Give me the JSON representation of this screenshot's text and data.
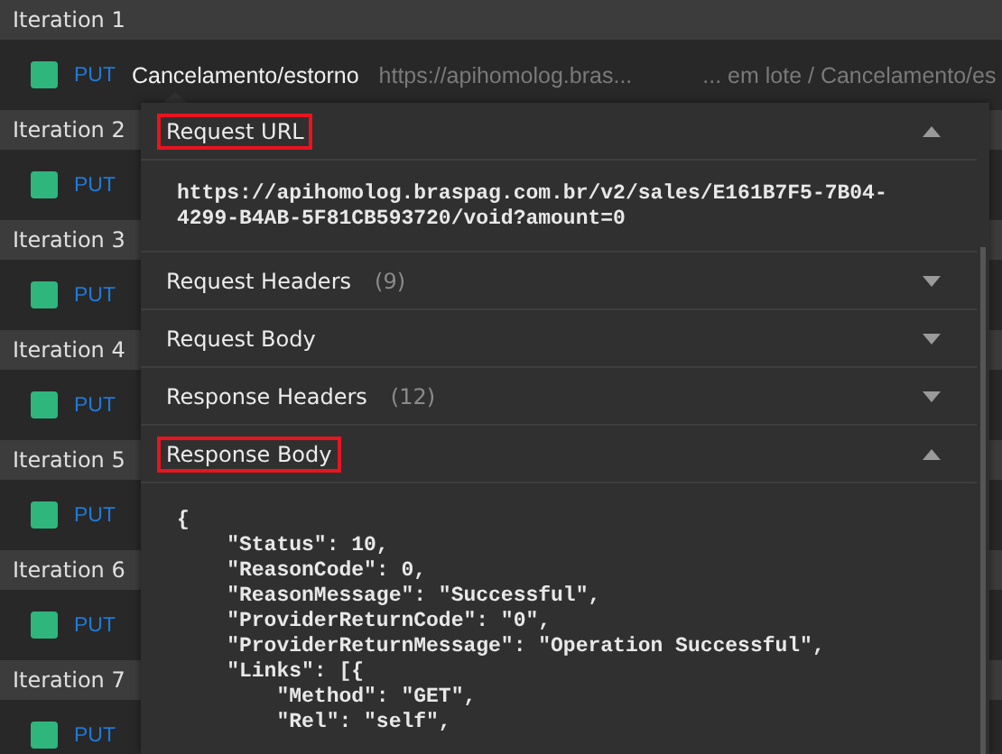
{
  "iterations": [
    {
      "title": "Iteration 1",
      "request": {
        "method": "PUT",
        "name": "Cancelamento/estorno",
        "url": "https://apihomolog.bras...",
        "path": "... em lote / Cancelamento/es"
      }
    },
    {
      "title": "Iteration 2",
      "request": {
        "method": "PUT"
      }
    },
    {
      "title": "Iteration 3",
      "request": {
        "method": "PUT"
      }
    },
    {
      "title": "Iteration 4",
      "request": {
        "method": "PUT"
      }
    },
    {
      "title": "Iteration 5",
      "request": {
        "method": "PUT"
      }
    },
    {
      "title": "Iteration 6",
      "request": {
        "method": "PUT"
      }
    },
    {
      "title": "Iteration 7",
      "request": {
        "method": "PUT"
      }
    }
  ],
  "details": {
    "sections": [
      {
        "title": "Request URL",
        "expanded": true,
        "highlighted": true,
        "kind": "text",
        "content": [
          "https://apihomolog.braspag.com.br/v2/sales/E161B7F5-7B04-",
          "4299-B4AB-5F81CB593720/void?amount=0"
        ]
      },
      {
        "title": "Request Headers",
        "count": "(9)",
        "expanded": false,
        "highlighted": false
      },
      {
        "title": "Request Body",
        "expanded": false,
        "highlighted": false
      },
      {
        "title": "Response Headers",
        "count": "(12)",
        "expanded": false,
        "highlighted": false
      },
      {
        "title": "Response Body",
        "expanded": true,
        "highlighted": true,
        "kind": "code",
        "content": [
          "{",
          "    \"Status\": 10,",
          "    \"ReasonCode\": 0,",
          "    \"ReasonMessage\": \"Successful\",",
          "    \"ProviderReturnCode\": \"0\",",
          "    \"ProviderReturnMessage\": \"Operation Successful\",",
          "    \"Links\": [{",
          "        \"Method\": \"GET\",",
          "        \"Rel\": \"self\","
        ]
      }
    ]
  }
}
